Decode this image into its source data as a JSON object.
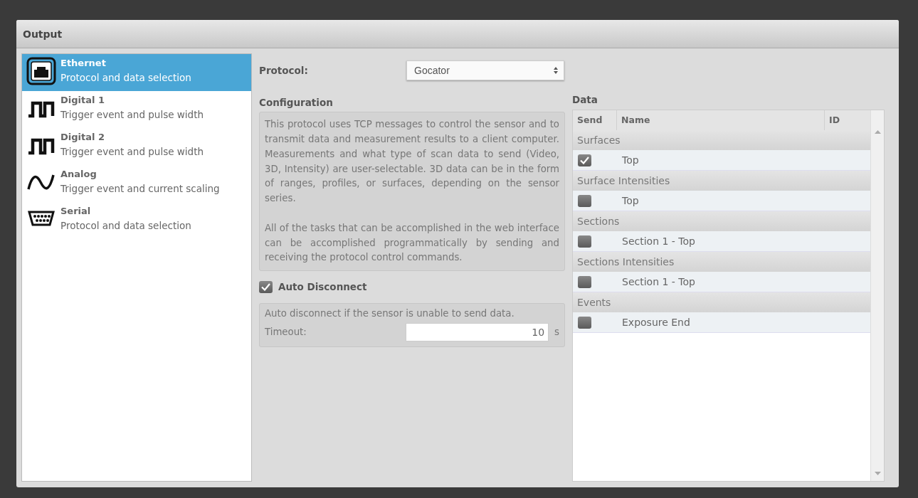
{
  "panel": {
    "title": "Output"
  },
  "sidebar": {
    "items": [
      {
        "kind": "ethernet",
        "title": "Ethernet",
        "subtitle": "Protocol and data selection",
        "selected": true
      },
      {
        "kind": "digital",
        "title": "Digital 1",
        "subtitle": "Trigger event and pulse width",
        "selected": false
      },
      {
        "kind": "digital",
        "title": "Digital 2",
        "subtitle": "Trigger event and pulse width",
        "selected": false
      },
      {
        "kind": "analog",
        "title": "Analog",
        "subtitle": "Trigger event and current scaling",
        "selected": false
      },
      {
        "kind": "serial",
        "title": "Serial",
        "subtitle": "Protocol and data selection",
        "selected": false
      }
    ]
  },
  "protocol": {
    "label": "Protocol:",
    "value": "Gocator"
  },
  "configuration": {
    "heading": "Configuration",
    "paragraphs": [
      "This protocol uses TCP messages to control the sensor and to transmit data and measurement results to a client computer. Measurements and what type of scan data to send (Video, 3D, Intensity) are user-selectable. 3D data can be in the form of ranges, profiles, or surfaces, depending on the sensor series.",
      "All of the tasks that can be accomplished in the web interface can be accomplished programmatically by sending and receiving the protocol control commands."
    ]
  },
  "auto_disconnect": {
    "label": "Auto Disconnect",
    "checked": true,
    "description": "Auto disconnect if the sensor is unable to send data.",
    "timeout_label": "Timeout:",
    "timeout_value": "10",
    "unit": "s"
  },
  "data": {
    "heading": "Data",
    "columns": [
      "Send",
      "Name",
      "ID"
    ],
    "groups": [
      {
        "name": "Surfaces",
        "rows": [
          {
            "name": "Top",
            "checked": true
          }
        ]
      },
      {
        "name": "Surface Intensities",
        "rows": [
          {
            "name": "Top",
            "checked": false
          }
        ]
      },
      {
        "name": "Sections",
        "rows": [
          {
            "name": "Section 1 - Top",
            "checked": false
          }
        ]
      },
      {
        "name": "Sections Intensities",
        "rows": [
          {
            "name": "Section 1 - Top",
            "checked": false
          }
        ]
      },
      {
        "name": "Events",
        "rows": [
          {
            "name": "Exposure End",
            "checked": false
          }
        ]
      }
    ]
  }
}
